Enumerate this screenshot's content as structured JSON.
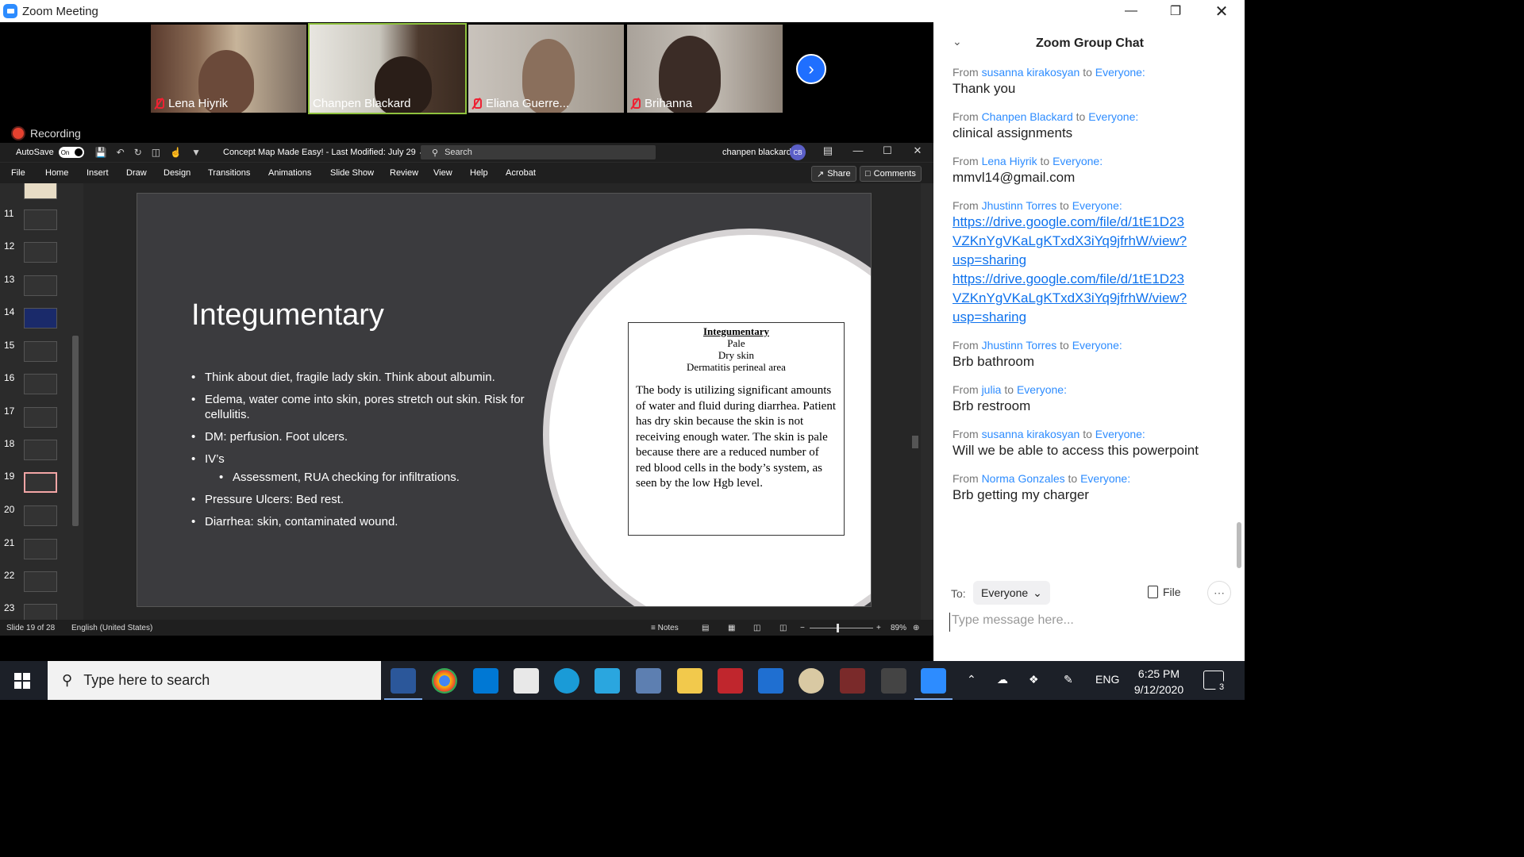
{
  "window": {
    "title": "Zoom Meeting"
  },
  "participants": [
    {
      "name": "Lena Hiyrik",
      "muted": true
    },
    {
      "name": "Chanpen Blackard",
      "muted": false,
      "active": true
    },
    {
      "name": "Eliana Guerre...",
      "muted": true
    },
    {
      "name": "Brihanna",
      "muted": true
    }
  ],
  "recording": {
    "label": "Recording"
  },
  "powerpoint": {
    "autosave_label": "AutoSave",
    "autosave_state": "On",
    "doc_title": "Concept Map Made Easy!  -  Last Modified: July 29  ⌄",
    "search_placeholder": "Search",
    "user_name": "chanpen blackard",
    "user_initials": "CB",
    "menu": [
      "File",
      "Home",
      "Insert",
      "Draw",
      "Design",
      "Transitions",
      "Animations",
      "Slide Show",
      "Review",
      "View",
      "Help",
      "Acrobat"
    ],
    "share_label": "Share",
    "comments_label": "Comments",
    "thumbnails": [
      "11",
      "12",
      "13",
      "14",
      "15",
      "16",
      "17",
      "18",
      "19",
      "20",
      "21",
      "22",
      "23"
    ],
    "selected_slide": "19",
    "slide": {
      "title": "Integumentary",
      "bullets": [
        {
          "text": "Think about diet, fragile lady skin. Think about albumin.",
          "level": 1
        },
        {
          "text": "Edema, water come into skin, pores stretch out skin. Risk for cellulitis.",
          "level": 1
        },
        {
          "text": "DM: perfusion. Foot ulcers.",
          "level": 1
        },
        {
          "text": "IV’s",
          "level": 1
        },
        {
          "text": "Assessment, RUA checking for infiltrations.",
          "level": 2
        },
        {
          "text": "Pressure Ulcers: Bed rest.",
          "level": 1
        },
        {
          "text": "Diarrhea: skin, contaminated wound.",
          "level": 1
        }
      ],
      "box_title": "Integumentary",
      "box_lines": [
        "Pale",
        "Dry skin",
        "Dermatitis perineal area"
      ],
      "box_body": "The body is utilizing significant amounts of water and fluid during diarrhea. Patient has dry skin because the skin is not receiving enough water. The skin is pale because there are a reduced number of red blood cells in the body’s system, as seen by the low Hgb level."
    },
    "status": {
      "slide_counter": "Slide 19 of 28",
      "language": "English (United States)",
      "notes_label": "Notes",
      "zoom_level": "89%"
    }
  },
  "chat": {
    "title": "Zoom Group Chat",
    "messages": [
      {
        "from": "susanna kirakosyan",
        "to": "Everyone:",
        "text": "Thank you"
      },
      {
        "from": "Chanpen Blackard",
        "to": "Everyone:",
        "text": "clinical assignments"
      },
      {
        "from": "Lena Hiyrik",
        "to": "Everyone:",
        "text": "mmvl14@gmail.com"
      },
      {
        "from": "Jhustinn Torres",
        "to": "Everyone:",
        "links": [
          [
            "https://drive.google.com/file/d/1tE1D23",
            "VZKnYgVKaLgKTxdX3iYq9jfrhW/view?",
            "usp=sharing"
          ],
          [
            "https://drive.google.com/file/d/1tE1D23",
            "VZKnYgVKaLgKTxdX3iYq9jfrhW/view?",
            "usp=sharing"
          ]
        ]
      },
      {
        "from": "Jhustinn Torres",
        "to": "Everyone:",
        "text": "Brb bathroom"
      },
      {
        "from": "julia",
        "to": "Everyone:",
        "text": "Brb restroom"
      },
      {
        "from": "susanna kirakosyan",
        "to": "Everyone:",
        "text": "Will we be able to access this powerpoint"
      },
      {
        "from": "Norma Gonzales",
        "to": "Everyone:",
        "text": "Brb getting my charger"
      }
    ],
    "from_word": "From",
    "to_word": "to",
    "to_label": "To:",
    "recipient": "Everyone",
    "file_label": "File",
    "input_placeholder": "Type message here..."
  },
  "taskbar": {
    "search_placeholder": "Type here to search",
    "language": "ENG",
    "time": "6:25 PM",
    "date": "9/12/2020",
    "notification_count": "3"
  },
  "colors": {
    "zoom_blue": "#2D8CFF",
    "recording_red": "#e5412f",
    "active_speaker": "#8fc23e"
  }
}
